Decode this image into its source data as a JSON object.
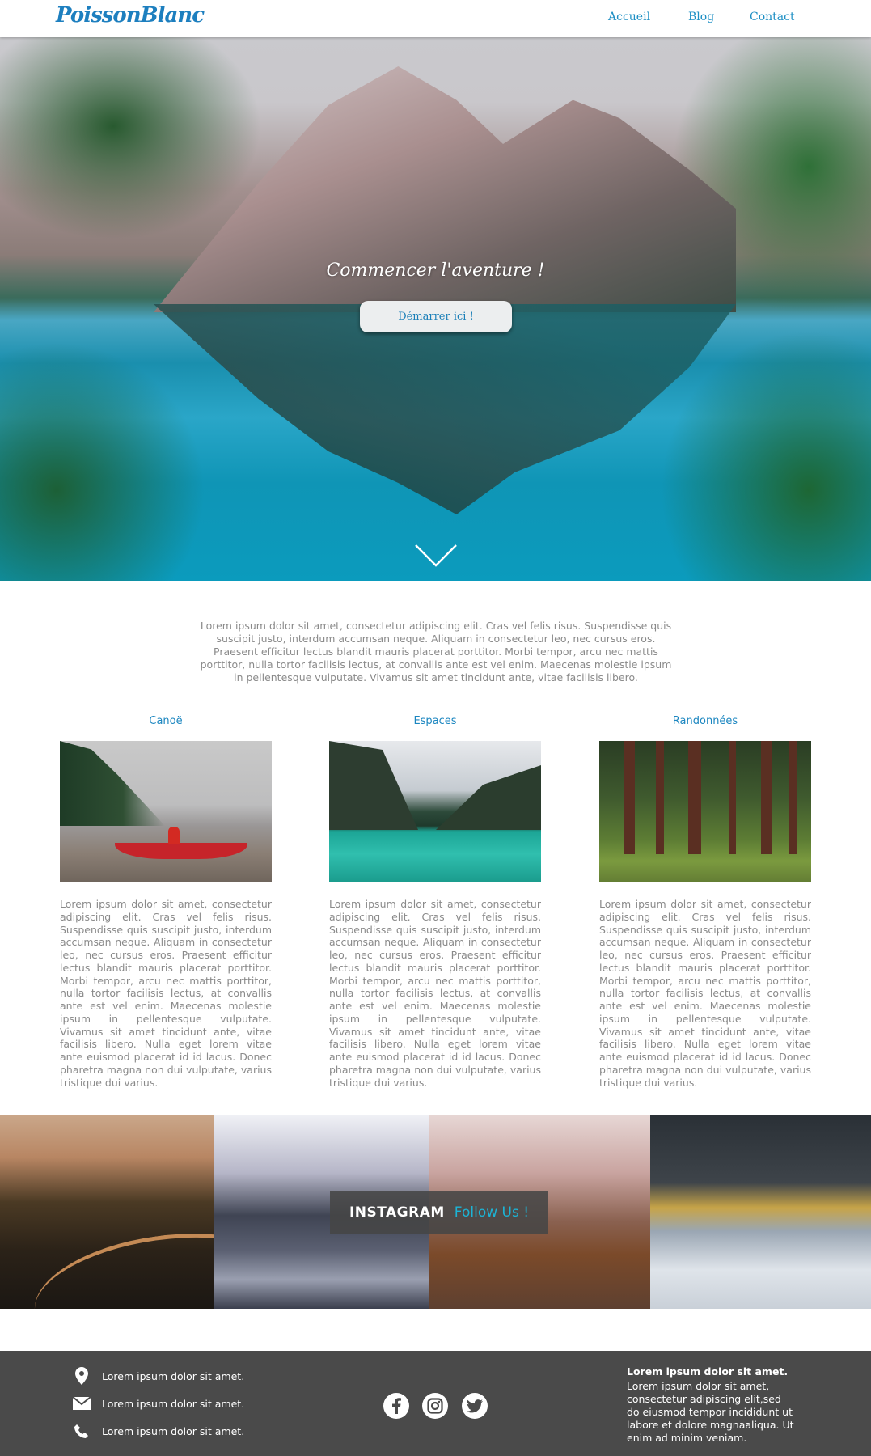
{
  "header": {
    "logo": "PoissonBlanc",
    "nav": [
      "Accueil",
      "Blog",
      "Contact"
    ]
  },
  "hero": {
    "title": "Commencer l'aventure !",
    "button": "Démarrer ici !",
    "scroll_icon": "chevron-down-icon"
  },
  "intro": {
    "text": "Lorem ipsum dolor sit amet, consectetur adipiscing elit. Cras vel felis risus. Suspendisse quis suscipit justo, interdum accumsan neque. Aliquam in consectetur leo, nec cursus eros. Praesent efficitur lectus blandit mauris placerat porttitor. Morbi tempor, arcu nec mattis porttitor, nulla tortor facilisis lectus, at convallis ante est vel enim. Maecenas molestie ipsum in pellentesque vulputate. Vivamus sit amet tincidunt ante, vitae facilisis libero."
  },
  "columns": [
    {
      "title": "Canoë",
      "text": "Lorem ipsum dolor sit amet, consectetur adipiscing elit. Cras vel felis risus. Suspendisse quis suscipit justo, interdum accumsan neque. Aliquam in consectetur leo, nec cursus eros. Praesent efficitur lectus blandit mauris placerat porttitor. Morbi tempor, arcu nec mattis porttitor, nulla tortor facilisis lectus, at convallis ante est vel enim. Maecenas molestie ipsum in pellentesque vulputate. Vivamus sit amet tincidunt ante, vitae facilisis libero. Nulla eget lorem vitae ante euismod placerat id id lacus. Donec pharetra magna non dui vulputate, varius tristique dui varius."
    },
    {
      "title": "Espaces",
      "text": "Lorem ipsum dolor sit amet, consectetur adipiscing elit. Cras vel felis risus. Suspendisse quis suscipit justo, interdum accumsan neque. Aliquam in consectetur leo, nec cursus eros. Praesent efficitur lectus blandit mauris placerat porttitor. Morbi tempor, arcu nec mattis porttitor, nulla tortor facilisis lectus, at convallis ante est vel enim. Maecenas molestie ipsum in pellentesque vulputate. Vivamus sit amet tincidunt ante, vitae facilisis libero. Nulla eget lorem vitae ante euismod placerat id id lacus. Donec pharetra magna non dui vulputate, varius tristique dui varius."
    },
    {
      "title": "Randonnées",
      "text": "Lorem ipsum dolor sit amet, consectetur adipiscing elit. Cras vel felis risus. Suspendisse quis suscipit justo, interdum accumsan neque. Aliquam in consectetur leo, nec cursus eros. Praesent efficitur lectus blandit mauris placerat porttitor. Morbi tempor, arcu nec mattis porttitor, nulla tortor facilisis lectus, at convallis ante est vel enim. Maecenas molestie ipsum in pellentesque vulputate. Vivamus sit amet tincidunt ante, vitae facilisis libero. Nulla eget lorem vitae ante euismod placerat id id lacus. Donec pharetra magna non dui vulputate, varius tristique dui varius."
    }
  ],
  "instagram": {
    "label": "INSTAGRAM",
    "cta": "Follow Us !"
  },
  "footer": {
    "contacts": [
      {
        "icon": "location-pin-icon",
        "text": "Lorem ipsum dolor sit amet."
      },
      {
        "icon": "envelope-icon",
        "text": "Lorem ipsum dolor sit amet."
      },
      {
        "icon": "phone-icon",
        "text": "Lorem ipsum dolor sit amet."
      }
    ],
    "social": [
      "facebook-icon",
      "instagram-icon",
      "twitter-icon"
    ],
    "about_title": "Lorem ipsum dolor sit amet.",
    "about_text": "Lorem ipsum dolor sit amet, consectetur adipiscing elit,sed do eiusmod tempor incididunt ut labore et dolore magnaaliqua. Ut enim ad minim veniam."
  },
  "colors": {
    "accent": "#1d8fc4",
    "footer_bg": "#4a4a4a",
    "instagram_cta": "#1cb4d6"
  }
}
